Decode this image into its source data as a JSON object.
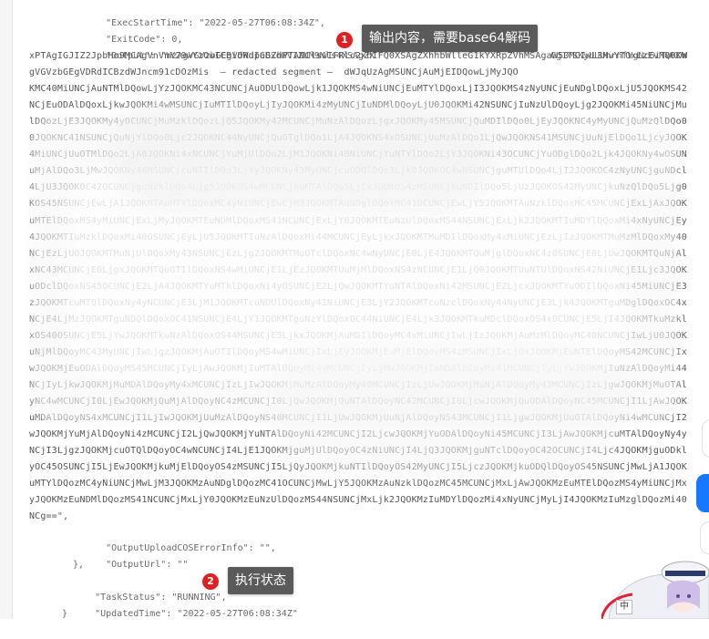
{
  "editor": {
    "lines": {
      "exec_start_key": "\"ExecStartTime\"",
      "exec_start_val": "\"2022-05-27T06:08:34Z\"",
      "exit_code_key": "\"ExitCode\"",
      "exit_code_val": "0",
      "output_key": "\"Output\"",
      "output_val_prefix": "\"WzAgVGVzbGEgVDRdICBxdWV1ZUM9Mls4XSAgZX",
      "output_val_suffix": "Cg1TSKyUUUnrnfVgNc6iTWKDWMV3PuMgRGVzbGEgVDRdICBidWdzYm4",
      "blob": [
        "xPTAgIGJIZ2JpbHo9MCAgVnVnY29wYzOwICBidWdpaGZhPTANClswIFRlc2xhIFQ0XSAgZXhhbWlleG1kYXRpZVhMSAgaW50MCIwL3MvYTOxLzEvMQOKWxA",
        "gVGVzbGEgVDRdICBzdWJncm91cDOzMis  — redacted segment —  dWJqUzAgMSUNCjAuMjEIDQowLjMyJQO",
        "KMC40MiUNCjAuNTMlDQowLjYzJQOKMC43NCUNCjAuODUlDQowLjk1JQOKMS4wNiUNCjEuMTYlDQoxLjI3JQOKMS4zNyUNCjEuNDglDQoxLjU5JQOKMS42OSU",
        "NCjEuODAlDQoxLjkwJQOKMi4wMSUNCjIuMTIlDQoyLjIyJQOKMi4zMyUNCjIuNDMlDQoyLjU0JQOKMi42NSUNCjIuNzUlDQoyLjg2JQOKMi45NiUNCjMuMDc",
        "lDQozLjE3JQOKMy4yOCUNCjMuMzklDQozLjQ5JQOKMy42MCUNCjMuNzAlDQozLjgxJQOKMy45MSUNCjQuMDIlDQo0LjEyJQOKNC4yMyUNCjQuMzQlDQo0LjQ",
        "0JQOKNC41NSUNCjQuNjYlDQo0Ljc2JQOKNC44NyUNCjQuOTglDQo1LjA4JQOKNS4xOSUNCjUuMzAlDQo1LjQwJQOKNS41MSUNCjUuNjElDQo1LjcyJQOKNS4",
        "4MiUNCjUuOTMlDQo2LjA0JQOKNi4xNCUNCjYuMjUlDQo2LjM1JQOKNi40NiUNCjYuNTYlDQo2LjY3JQOKNi43OCUNCjYuODglDQo2Ljk4JQOKNy4wOSUNCjc",
        "uMjAlDQo3LjMwJQOKNy40MSUNCjcuNTIlDQo3LjYyJQOKNy43MyUNCjcuODQlDQo3Ljk0JQOKOC4wNSUNCjguMTUlDQo4LjI2JQOKOC4zNyUNCjguNDclDQo",
        "4LjU3JQOKOC42OCUNCjguNzklDQo4Ljg5JQOKOS4wMCUNCjkuMTAlDQo5LjIxJQOKOS4zMSUNCjkuNDIlDQo5LjUzJQOKOS42MyUNCjkuNzQlDQo5Ljg0JQO",
        "KOS45NSUNCjEwLjA1JQOKMTAuMTYlDQoxMC4yNiUNCjEwLjM3JQOKMTAuNDglDQoxMC41OCUNCjEwLjY5JQOKMTAuNzklDQoxMC45MCUNCjExLjAxJQOKMTE",
        "uMTElDQoxMS4yMiUNCjExLjMyJQOKMTEuNDMlDQoxMS41NCUNCjExLjY0JQOKMTEuNzUlDQoxMS44NSUNCjExLjk2JQOKMTIuMDYlDQoxMi4xNyUNCjEyLjI",
        "4JQOKMTIuMzklDQoxMi40OSUNCjEyLjU5JQOKMTIuNzAlDQoxMi44MCUNCjEyLjkxJQOKMTMuMDIlDQoxMy4xMiUNCjEzLjIzJQOKMTMuMzMlDQoxMy40NCU",
        "NCjEzLjU0JQOKMTMuNjUlDQoxMy43NSUNCjEzLjg2JQOKMTMuOTclDQoxNC4wNyUNCjE0LjE4JQOKMTQuMjglDQoxNC4zOSUNCjE0LjUwJQOKMTQuNjAlDQo",
        "xNC43MCUNCjE0LjgxJQOKMTQuOTIlDQoxNS4wMiUNCjE1LjEzJQOKMTUuMjMlDQoxNS4zNCUNCjE1LjQ0JQOKMTUuNTUlDQoxNS42NiUNCjE1Ljc3JQOKMTU",
        "uODclDQoxNS45OCUNCjE2LjA4JQOKMTYuMTklDQoxNi4yOSUNCjE2LjQwJQOKMTYuNTAlDQoxNi42MSUNCjE2LjcxJQOKMTYuODIlDQoxNi45MiUNCjE3LjA",
        "zJQOKMTcuMTQlDQoxNy4yNCUNCjE3LjM1JQOKMTcuNDUlDQoxNy41NiUNCjE3LjY2JQOKMTcuNzclDQoxNy44NyUNCjE3Ljk4JQOKMTguMDglDQoxOC4xOCU",
        "NCjE4LjMzJQOKMTguNDQlDQoxOC41NSUNCjE4LjY1JQOKMTguNzYlDQoxOC44NiUNCjE4Ljk3JQOKMTkuMDclDQoxOS4xOCUNCjE5LjI4JQOKMTkuMzklDQo",
        "xOS40OSUNCjE5LjYwJQOKMTkuNzAlDQoxOS44MSUNCjE5LjkxJQOKMjAuMDIlDQoyMC4xMiUNCjIwLjIzJQOKMjAuMzMlDQoyMC40NCUNCjIwLjU0JQOKMjA",
        "uNjMlDQoyMC43MyUNCjIwLjgzJQOKMjAuOTIlDQoyMS4wMiUNCjIxLjEyJQOKMjEuMjElDQoyMS4zMSUNCjIxLjQxJQOKMjEuNTElDQoyMS42MCUNCjIxLjc",
        "wJQOKMjEuODAlDQoyMS45MCUNCjIyLjAwJQOKMjIuMTAlDQoyMi4yMCUNCjIyLjMwJQOKMjIuNDAlDQoyMi41MCUNCjIyLjYwJQOKMjIuNzAlDQoyMi44MCU",
        "NCjIyLjkwJQOKMjMuMDAlDQoyMy4xMCUNCjIzLjIwJQOKMjMuMzAlDQoyMy40MCUNCjIzLjUwJQOKMjMuNjAlDQoyMy43MCUNCjIzLjgwJQOKMjMuOTAlDQo",
        "yNC4wMCUNCjI0LjEwJQOKMjQuMjAlDQoyNC4zMCUNCjI0LjQwJQOKMjQuNTAlDQoyNC42MCUNCjI0LjcwJQOKMjQuODAlDQoyNC45MCUNCjI1LjAwJQOKMjU",
        "uMDAlDQoyNS4xMCUNCjI1LjIwJQOKMjUuMzAlDQoyNS40MCUNCjI1LjUwJQOKMjUuNjAlDQoyNS43MCUNCjI1LjgwJQOKMjUuOTAlDQoyNi4wMCUNCjI2LjE",
        "wJQOKMjYuMjAlDQoyNi4zMCUNCjI2LjQwJQOKMjYuNTAlDQoyNi42MCUNCjI2LjcwJQOKMjYuODAlDQoyNi45MCUNCjI3LjAwJQOKMjcuMTAlDQoyNy4yMCU",
        "NCjI3LjgzJQOKMjcuOTQlDQoyOC4wNCUNCjI4LjE1JQOKMjguMjUlDQoyOC4zNiUNCjI4LjQ3JQOKMjguNTclDQoyOC42OCUNCjI4Ljc4JQOKMjguODklDQo",
        "yOC45OSUNCjI5LjEwJQOKMjkuMjElDQoyOS4zMSUNCjI5LjQyJQOKMjkuNTIlDQoyOS42MyUNCjI5LjczJQOKMjkuODQlDQoyOS45NSUNCjMwLjA1JQOKMzA",
        "uMTYlDQozMC4yNiUNCjMwLjM3JQOKMzAuNDglDQozMC41OCUNCjMwLjY5JQOKMzAuNzklDQozMC45MCUNCjMxLjAwJQOKMzEuMTElDQozMS4yMiUNCjMxLjM",
        "yJQOKMzEuNDMlDQozMS41NCUNCjMxLjY0JQOKMzEuNzUlDQozMS44NSUNCjMxLjk2JQOKMzIuMDYlDQozMi4xNyUNCjMyLjI4JQOKMzIuMzglDQozMi40OSU",
        "NCg==\","
      ],
      "output_upload_key": "\"OutputUploadCOSErrorInfo\"",
      "output_upload_val": "\"\"",
      "output_url_key": "\"OutputUrl\"",
      "output_url_val": "\"\"",
      "close_brace_inner": "},",
      "task_status_key": "\"TaskStatus\"",
      "task_status_val": "\"RUNNING\"",
      "updated_key": "\"UpdatedTime\"",
      "updated_val": "\"2022-05-27T06:08:34Z\"",
      "close_brace_outer": "}"
    }
  },
  "annotations": [
    {
      "number": "1",
      "text": "输出内容，需要base64解码"
    },
    {
      "number": "2",
      "text": "执行状态"
    }
  ],
  "widgets": {
    "mascot_label": "中"
  },
  "colors": {
    "badge_red": "#e02020",
    "tooltip_bg": "#5a5a5a",
    "side_blue": "#1677ff"
  }
}
